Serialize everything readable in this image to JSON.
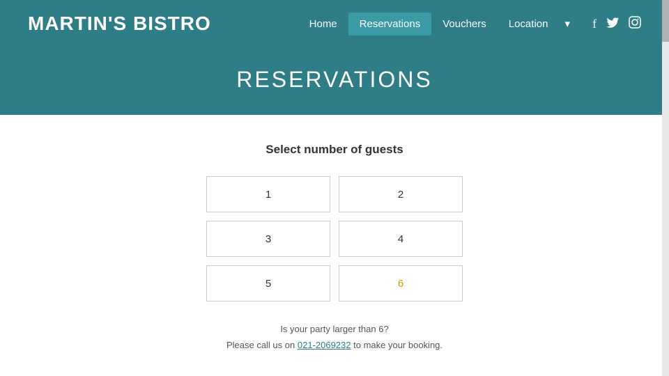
{
  "site": {
    "title": "MARTIN'S BISTRO"
  },
  "nav": {
    "home_label": "Home",
    "reservations_label": "Reservations",
    "vouchers_label": "Vouchers",
    "location_label": "Location",
    "more_label": "▾"
  },
  "social": {
    "facebook": "f",
    "twitter": "🐦",
    "instagram": "◎"
  },
  "hero": {
    "title": "RESERVATIONS"
  },
  "main": {
    "section_label": "Select number of guests",
    "guests": [
      {
        "value": "1",
        "highlighted": false
      },
      {
        "value": "2",
        "highlighted": false
      },
      {
        "value": "3",
        "highlighted": false
      },
      {
        "value": "4",
        "highlighted": false
      },
      {
        "value": "5",
        "highlighted": false
      },
      {
        "value": "6",
        "highlighted": true
      }
    ],
    "footer_line1": "Is your party larger than 6?",
    "footer_line2_prefix": "Please call us on ",
    "footer_phone": "021-2069232",
    "footer_line2_suffix": " to make your booking."
  }
}
